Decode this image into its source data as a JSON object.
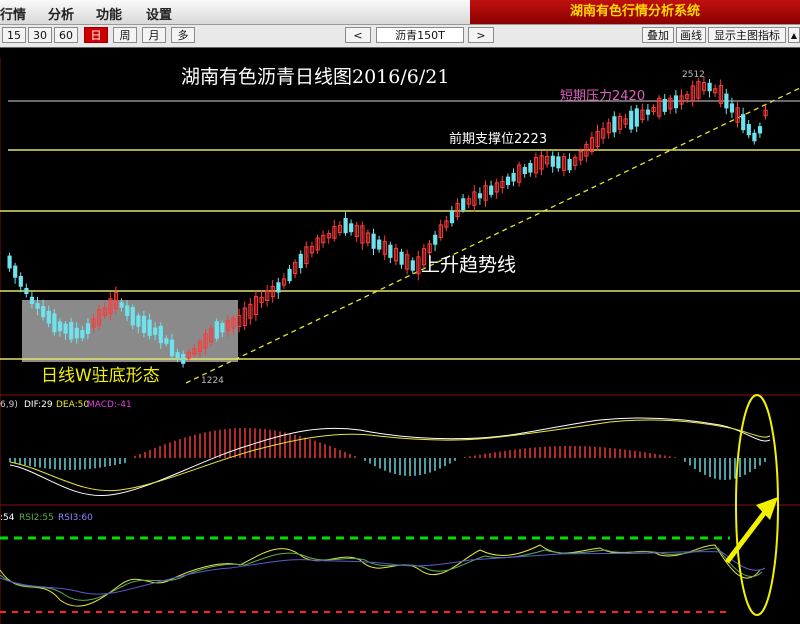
{
  "menu": {
    "items": [
      "行情",
      "分析",
      "功能",
      "设置"
    ],
    "app_title": "湖南有色行情分析系统"
  },
  "toolbar": {
    "periods": [
      "15",
      "30",
      "60",
      "日",
      "周",
      "月",
      "多"
    ],
    "active_period": "日",
    "prev_label": "<",
    "next_label": ">",
    "symbol": "沥青150T",
    "overlay_label": "叠加",
    "draw_label": "画线",
    "show_indicator_label": "显示主图指标",
    "scroll_label": "▲"
  },
  "chart": {
    "title": "湖南有色沥青日线图2016/6/21",
    "high_label": "2512",
    "low_label": "1224",
    "resistance_note": "短期压力2420",
    "support_note": "前期支撑位2223",
    "trend_note": "上升趋势线",
    "pattern_note": "日线W驻底形态"
  },
  "macd": {
    "params": "6,9)",
    "dif": "DIF:29",
    "dea": "DEA:50",
    "macd": "MACD:-41"
  },
  "rsi": {
    "rsi1": ":54",
    "rsi2": "RSI2:55",
    "rsi3": "RSI3:60"
  },
  "colors": {
    "up": "#ff3b3b",
    "down": "#6ee3ee",
    "level_line": "#e3e36a",
    "trend_line": "#e6e630",
    "dif_line": "#ffffff",
    "dea_line": "#e6e640",
    "rsi_upper_dash": "#00dd00",
    "rsi_lower_dash": "#ff2020"
  }
}
